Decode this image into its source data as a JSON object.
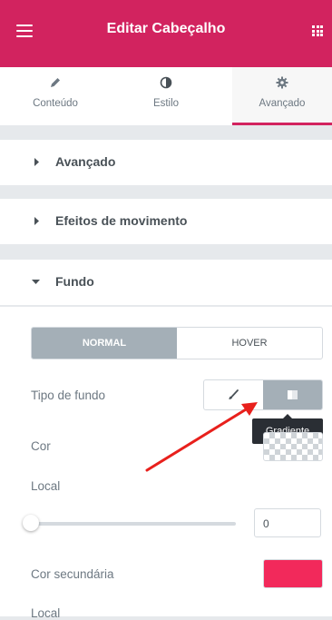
{
  "header": {
    "title": "Editar Cabeçalho",
    "menu_icon": "hamburger-menu-icon",
    "apps_icon": "grid-icon"
  },
  "tabs": [
    {
      "label": "Conteúdo",
      "icon": "pencil-icon",
      "active": false
    },
    {
      "label": "Estilo",
      "icon": "half-circle-icon",
      "active": false
    },
    {
      "label": "Avançado",
      "icon": "gear-icon",
      "active": true
    }
  ],
  "sections": [
    {
      "label": "Avançado",
      "expanded": false
    },
    {
      "label": "Efeitos de movimento",
      "expanded": false
    },
    {
      "label": "Fundo",
      "expanded": true
    }
  ],
  "fundo": {
    "state_tabs": [
      {
        "label": "NORMAL",
        "active": true
      },
      {
        "label": "HOVER",
        "active": false
      }
    ],
    "background_type": {
      "label": "Tipo de fundo",
      "options": [
        {
          "icon": "brush-icon",
          "active": false
        },
        {
          "icon": "gradient-icon",
          "active": true
        }
      ],
      "tooltip": "Gradiente"
    },
    "color": {
      "label": "Cor"
    },
    "location": {
      "label": "Local",
      "slider_value": 0,
      "input_value": "0"
    },
    "secondary_color": {
      "label": "Cor secundária",
      "value": "#f2295b"
    },
    "location2": {
      "label": "Local"
    }
  },
  "colors": {
    "brand": "#d2235f",
    "annotation_arrow": "#e8201c"
  }
}
